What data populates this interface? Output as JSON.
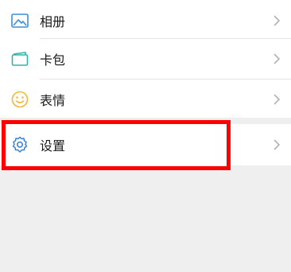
{
  "menu": {
    "items": [
      {
        "label": "相册",
        "icon": "image-icon"
      },
      {
        "label": "卡包",
        "icon": "card-wallet-icon"
      },
      {
        "label": "表情",
        "icon": "smiley-icon"
      }
    ],
    "settings": {
      "label": "设置",
      "icon": "gear-icon"
    }
  },
  "colors": {
    "background": "#efefef",
    "row_background": "#ffffff",
    "album_icon": "#3b8fd8",
    "cards_icon": "#2fb5a8",
    "stickers_icon": "#f0b93a",
    "settings_icon": "#3b7fd0",
    "chevron": "#b3b3b3",
    "highlight": "#ff0000"
  }
}
